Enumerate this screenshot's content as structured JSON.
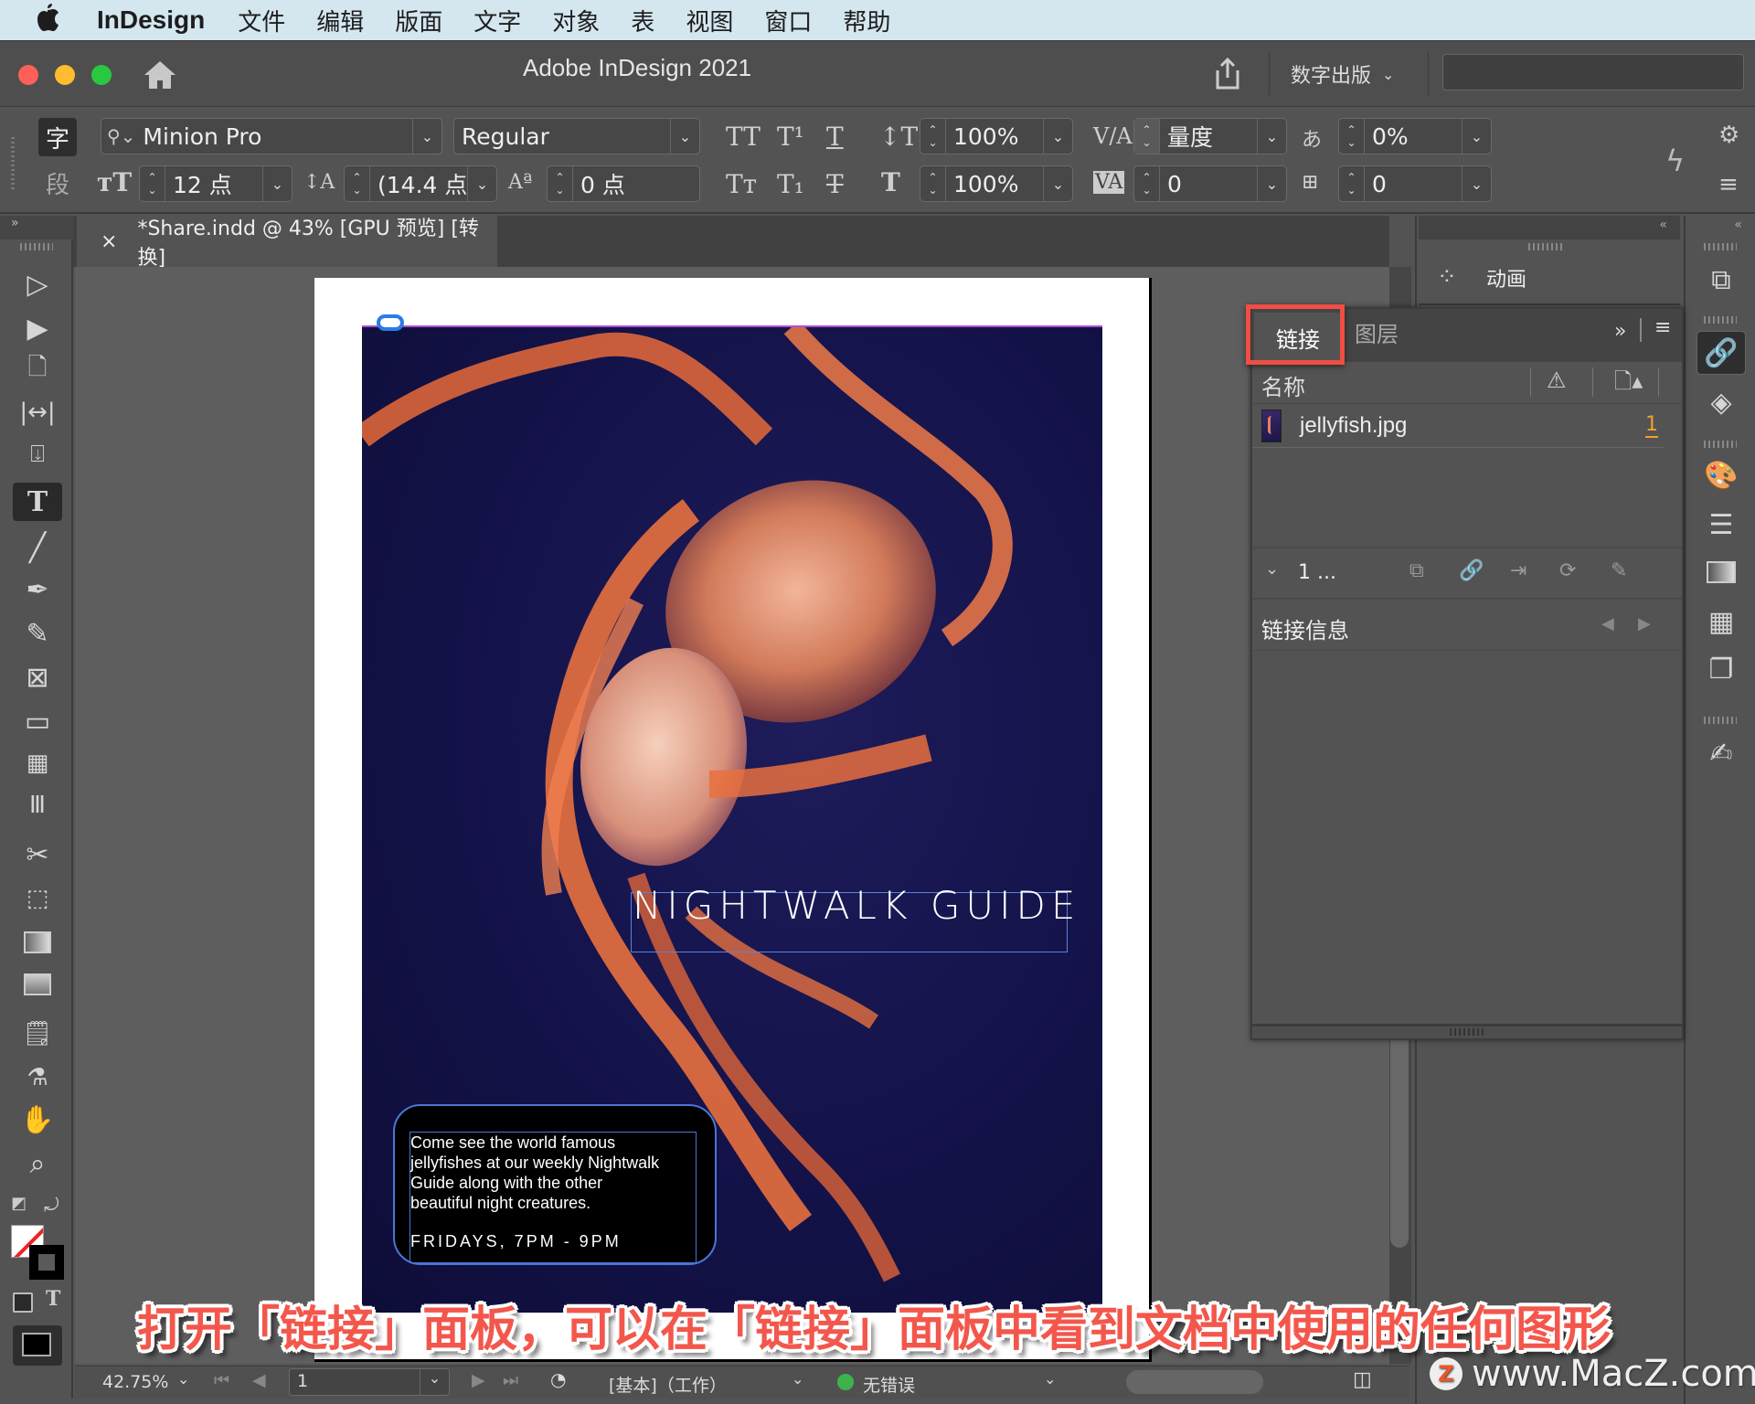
{
  "menubar": {
    "app_name": "InDesign",
    "items": [
      "文件",
      "编辑",
      "版面",
      "文字",
      "对象",
      "表",
      "视图",
      "窗口",
      "帮助"
    ]
  },
  "titlebar": {
    "title": "Adobe InDesign 2021",
    "workspace": "数字出版",
    "search_value": ""
  },
  "control_panel": {
    "char_mode": "字",
    "para_mode": "段",
    "font_family": "Minion Pro",
    "font_style": "Regular",
    "font_size": "12 点",
    "leading": "(14.4 点",
    "baseline_shift": "0 点",
    "vertical_scale": "100%",
    "horizontal_scale": "100%",
    "kerning": "量度",
    "tracking": "0",
    "tsume": "0%",
    "grid_spacing": "0"
  },
  "document_tab": {
    "close": "×",
    "label": "*Share.indd @ 43% [GPU 预览] [转换]"
  },
  "document": {
    "headline": "NIGHTWALK GUIDE",
    "body_lines": [
      "Come see the world famous",
      "jellyfishes at our weekly Nightwalk",
      "Guide along with the other",
      "beautiful night creatures."
    ],
    "schedule": "FRIDAYS, 7PM - 9PM"
  },
  "animation_panel": {
    "label": "动画"
  },
  "links_panel": {
    "tabs": [
      {
        "label": "链接",
        "active": true
      },
      {
        "label": "图层",
        "active": false
      }
    ],
    "column_name": "名称",
    "links": [
      {
        "name": "jellyfish.jpg",
        "page": "1"
      }
    ],
    "selection_count": "1 ...",
    "link_info_label": "链接信息",
    "accent_color": "#f0a030"
  },
  "statusbar": {
    "zoom": "42.75%",
    "page": "1",
    "profile": "[基本]（工作）",
    "preflight": "无错误",
    "preflight_color": "#3cb44b"
  },
  "caption": "打开「链接」面板，可以在「链接」面板中看到文档中使用的任何图形",
  "watermark": "www.MacZ.com",
  "watermark_logo": "Z",
  "highlight_color": "#f04d43"
}
